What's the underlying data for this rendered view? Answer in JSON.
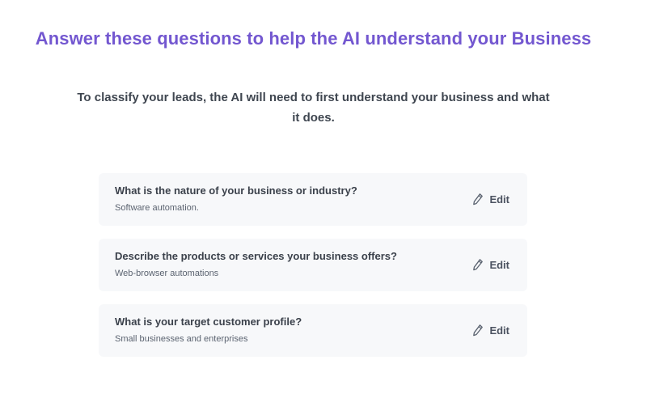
{
  "header": {
    "title": "Answer these questions to help the AI understand your Business",
    "intro": "To classify your leads, the AI will need to first understand your business and what it does."
  },
  "questions": [
    {
      "question": "What is the nature of your business or industry?",
      "answer": "Software automation.",
      "edit_label": "Edit",
      "edit_icon": "pencil-icon"
    },
    {
      "question": "Describe the products or services your business offers?",
      "answer": "Web-browser automations",
      "edit_label": "Edit",
      "edit_icon": "pencil-icon"
    },
    {
      "question": "What is your target customer profile?",
      "answer": "Small businesses and enterprises",
      "edit_label": "Edit",
      "edit_icon": "pencil-icon"
    }
  ],
  "colors": {
    "title": "#7357d0",
    "card_background": "#f7f8fa",
    "text": "#3b414b"
  }
}
